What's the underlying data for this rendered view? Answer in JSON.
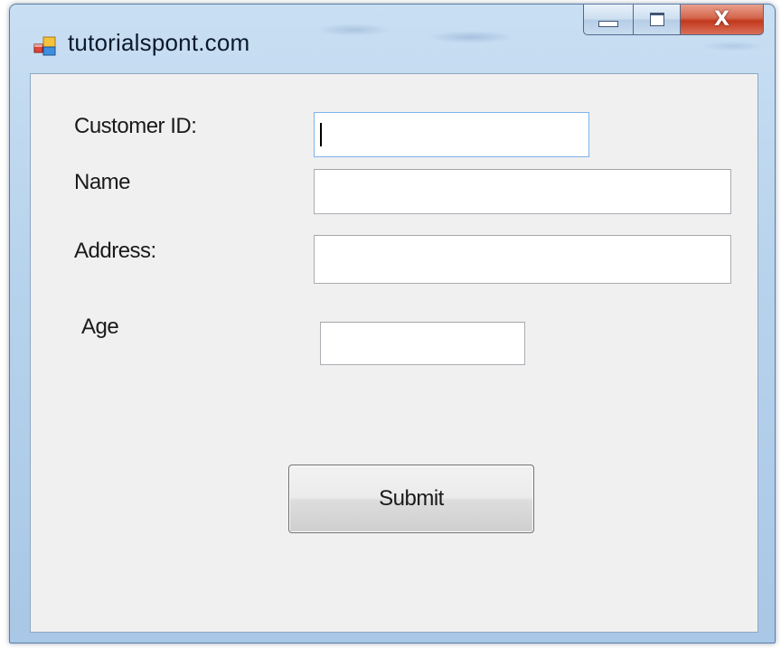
{
  "window": {
    "title": "tutorialspont.com",
    "icon": "winforms-app-icon",
    "controls": {
      "minimize_icon": "minimize-icon",
      "maximize_icon": "maximize-icon",
      "close_icon": "close-icon",
      "close_glyph": "X"
    }
  },
  "form": {
    "customer_id": {
      "label": "Customer ID:",
      "value": ""
    },
    "name": {
      "label": "Name",
      "value": ""
    },
    "address": {
      "label": "Address:",
      "value": ""
    },
    "age": {
      "label": "Age",
      "value": ""
    },
    "submit_label": "Submit"
  },
  "colors": {
    "close_button": "#c2381c",
    "client_background": "#f0f0f0",
    "focused_border": "#7eb4ea"
  }
}
